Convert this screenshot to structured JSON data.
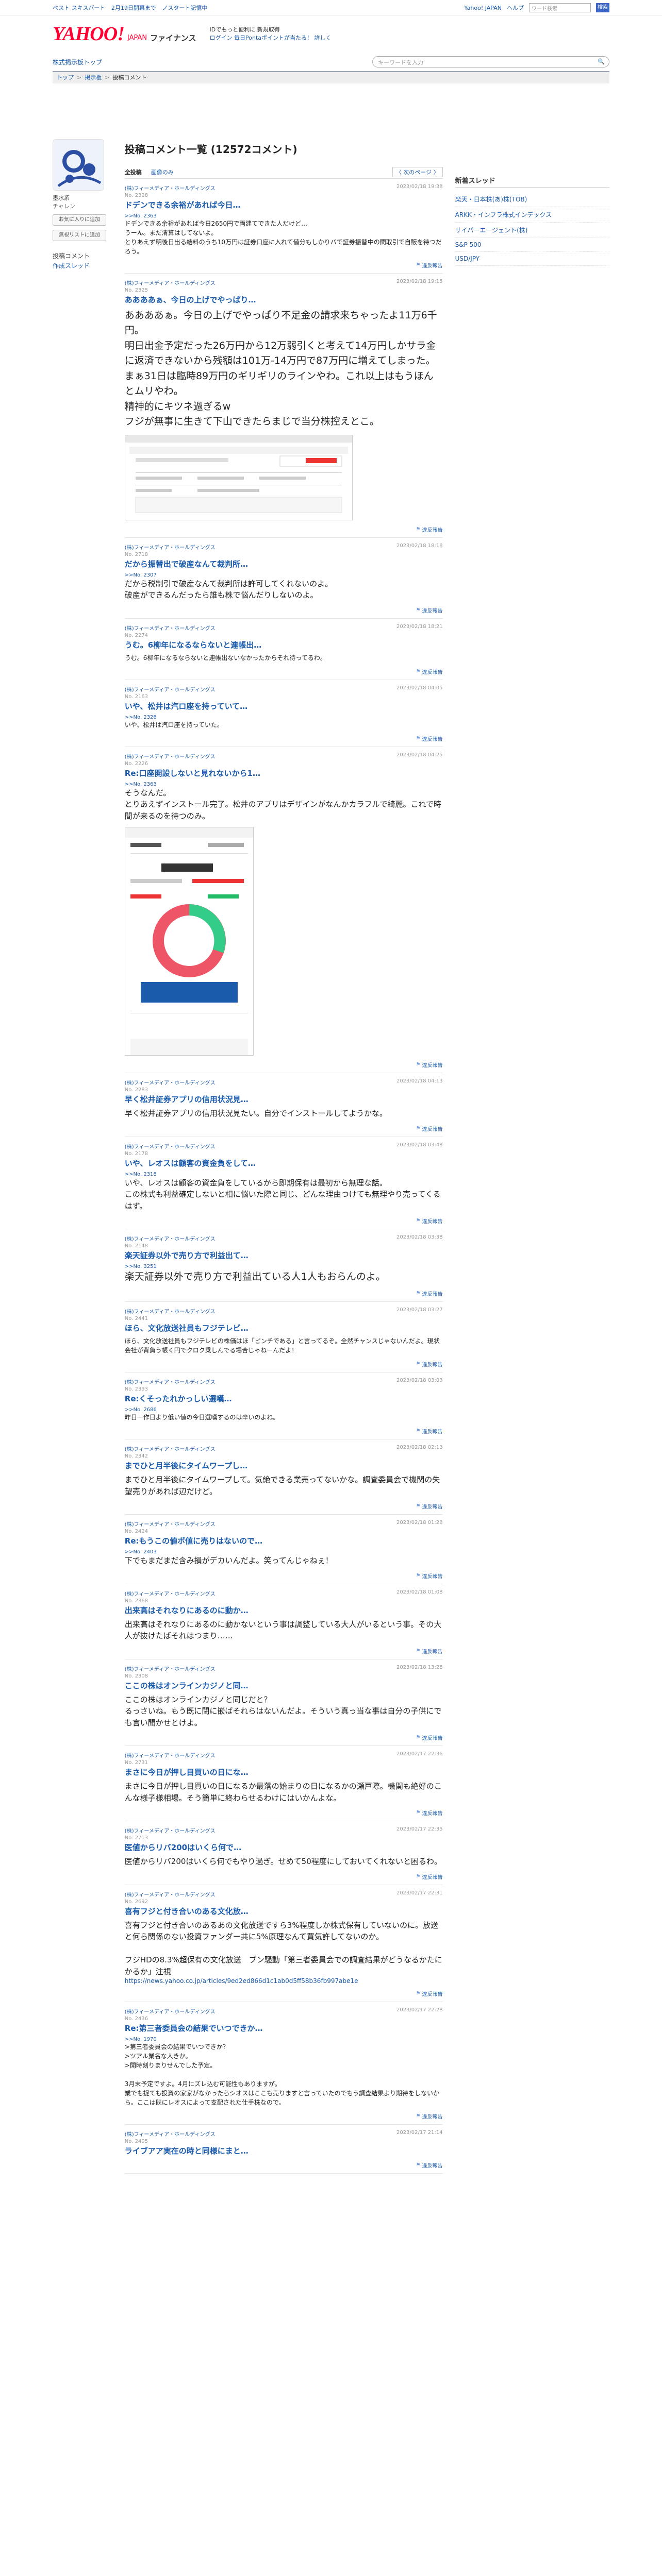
{
  "topbar": {
    "links": [
      "ベスト スキスパート",
      "2月19日開幕まで",
      "ノスタート記憶中"
    ],
    "right_links": [
      "Yahoo! JAPAN",
      "ヘルプ"
    ],
    "search_placeholder": "ワード検索",
    "search_btn": "検索"
  },
  "masthead": {
    "logo": "YAHOO!",
    "logo_sub": "JAPAN",
    "service": "ファイナンス",
    "promo1": "IDでもっと便利に 新規取得",
    "promo2": "ログイン 毎日Pontaポイントが当たる！ 詳しく"
  },
  "subnav": {
    "home": "株式掲示板トップ",
    "search_placeholder": "キーワードを入力"
  },
  "breadcrumb": [
    "トップ",
    "掲示板",
    "投稿コメント"
  ],
  "user": {
    "name": "墨水系",
    "role": "チャレン",
    "btn_follow": "お気に入りに追加",
    "btn_ignore": "無視リストに追加",
    "link_comments": "投稿コメント",
    "link_threads": "作成スレッド"
  },
  "page": {
    "title": "投稿コメント一覧 (12572コメント)",
    "tab_all": "全投稿",
    "tab_images": "画像のみ",
    "pager": "〈 次のページ 〉"
  },
  "right": {
    "title": "新着スレッド",
    "items": [
      "楽天・日本株(あ)株(TOB)",
      "ARKK・インフラ株式インデックス",
      "サイバーエージェント(株)",
      "S&P 500",
      "USD/JPY"
    ]
  },
  "report": "違反報告",
  "posts": [
    {
      "name": "(株)フィーメディア・ホールディングス",
      "no": "No. 2328",
      "date": "2023/02/18 19:38",
      "title": "ドデンできる余裕があれば今日…",
      "reply": ">>No. 2363",
      "body": "ドデンできる余裕があれば今日2650円で両建てできた人だけど…\nうーん。まだ清算はしてないよ。\nとりあえず明後日出る結料のうち10万円は証券口座に入れて値分もしかりバで証券振替中の間取引で自販を待つだろう。",
      "size": "sm"
    },
    {
      "name": "(株)フィーメディア・ホールディングス",
      "no": "No. 2325",
      "date": "2023/02/18 19:15",
      "title": "ああああぁ、今日の上げでやっぱり…",
      "reply": "",
      "body": "ああああぁ。今日の上げでやっぱり不足金の請求来ちゃったよ11万6千円。\n明日出金予定だった26万円から12万弱引くと考えて14万円しかサラ金に返済できないから残額は101万-14万円で87万円に増えてしまった。まぁ31日は臨時89万円のギリギリのラインやわ。これ以上はもうほんとムリやわ。\n精神的にキツネ過ぎるw\nフジが無事に生きて下山できたらまじで当分株控えとこ。",
      "size": "big",
      "shot": "1"
    },
    {
      "name": "(株)フィーメディア・ホールディングス",
      "no": "No. 2718",
      "date": "2023/02/18 18:18",
      "title": "だから振替出で破産なんて裁判所…",
      "reply": ">>No. 2307",
      "body": "だから税制引で破産なんて裁判所は許可してくれないのよ。\n破産ができるんだったら誰も株で悩んだりしないのよ。",
      "size": "med"
    },
    {
      "name": "(株)フィーメディア・ホールディングス",
      "no": "No. 2274",
      "date": "2023/02/18 18:21",
      "title": "うむ。6柳年になるならないと連帳出…",
      "reply": "",
      "body": "うむ。6柳年になるならないと連帳出ないなかったからそれ待ってるわ。",
      "size": "sm"
    },
    {
      "name": "(株)フィーメディア・ホールディングス",
      "no": "No. 2163",
      "date": "2023/02/18 04:05",
      "title": "いや、松井は汽ロ座を持っていて…",
      "reply": ">>No. 2326",
      "body": "いや、松井は汽ロ座を持っていた。",
      "size": "sm"
    },
    {
      "name": "(株)フィーメディア・ホールディングス",
      "no": "No. 2226",
      "date": "2023/02/18 04:25",
      "title": "Re:口座開設しないと見れないから1&hellip;",
      "reply": ">>No. 2363",
      "body": "そうなんだ。\nとりあえずインストール完了。松井のアプリはデザインがなんかカラフルで綺麗。これで時間が来るのを待つのみ。",
      "size": "med",
      "shot": "2"
    },
    {
      "name": "(株)フィーメディア・ホールディングス",
      "no": "No. 2283",
      "date": "2023/02/18 04:13",
      "title": "早く松井証券アプリの信用状況見…",
      "reply": "",
      "body": "早く松井証券アプリの信用状況見たい。自分でインストールしてようかな。",
      "size": "med"
    },
    {
      "name": "(株)フィーメディア・ホールディングス",
      "no": "No. 2178",
      "date": "2023/02/18 03:48",
      "title": "いや、レオスは顧客の資金負をして…",
      "reply": ">>No. 2318",
      "body": "いや、レオスは顧客の資金負をしているから即期保有は最初から無理な話。\nこの株式も利益確定しないと相に悩いた際と同じ、どんな理由つけても無理やり売ってくるはず。",
      "size": "med"
    },
    {
      "name": "(株)フィーメディア・ホールディングス",
      "no": "No. 2148",
      "date": "2023/02/18 03:38",
      "title": "楽天証券以外で売り方で利益出て…",
      "reply": ">>No. 3251",
      "body": "楽天証券以外で売り方で利益出ている人1人もおらんのよ。",
      "size": "big"
    },
    {
      "name": "(株)フィーメディア・ホールディングス",
      "no": "No. 2441",
      "date": "2023/02/18 03:27",
      "title": "ほら、文化放送社員もフジテレビ…",
      "reply": "",
      "body": "ほら、文化放送社員もフジテレビの株価はほ「ピンチである」と言ってるぞ。全然チャンスじゃないんだよ。現状会社が背負う帳く円でクロク乗しんでる場合じゃねーんだよ！",
      "size": "sm"
    },
    {
      "name": "(株)フィーメディア・ホールディングス",
      "no": "No. 2393",
      "date": "2023/02/18 03:03",
      "title": "Re:くそったれかっしい選嘆&hellip;",
      "reply": ">>No. 2686",
      "body": "昨日一作日より低い値の今日選嘆するのは辛いのよね。",
      "size": "sm"
    },
    {
      "name": "(株)フィーメディア・ホールディングス",
      "no": "No. 2342",
      "date": "2023/02/18 02:13",
      "title": "までひと月半後にタイムワープし…",
      "reply": "",
      "body": "までひと月半後にタイムワープして。気絶できる業売ってないかな。調査委員会で機関の失望売りがあれば辺だけど。",
      "size": "med"
    },
    {
      "name": "(株)フィーメディア・ホールディングス",
      "no": "No. 2424",
      "date": "2023/02/18 01:28",
      "title": "Re:もうこの値ボ値に売りはないので&hellip;",
      "reply": ">>No. 2403",
      "body": "下でもまだまだ含み損がデカいんだよ。笑ってんじゃねぇ！",
      "size": "med"
    },
    {
      "name": "(株)フィーメディア・ホールディングス",
      "no": "No. 2368",
      "date": "2023/02/18 01:08",
      "title": "出来高はそれなりにあるのに動か…",
      "reply": "",
      "body": "出来高はそれなりにあるのに動かないという事は調整している大人がいるという事。その大人が抜けたばそれはつまり……",
      "size": "med"
    },
    {
      "name": "(株)フィーメディア・ホールディングス",
      "no": "No. 2308",
      "date": "2023/02/18 13:28",
      "title": "ここの株はオンラインカジノと同…",
      "reply": "",
      "body": "ここの株はオンラインカジノと同じだと？\nるっさいね。もう既に閉に嵌ばそれらはないんだよ。そういう真っ当な事は自分の子供にでも言い聞かせとけよ。",
      "size": "med"
    },
    {
      "name": "(株)フィーメディア・ホールディングス",
      "no": "No. 2731",
      "date": "2023/02/17 22:36",
      "title": "まさに今日が押し目買いの日にな…",
      "reply": "",
      "body": "まさに今日が押し目買いの日になるか最落の始まりの日になるかの瀬戸際。機関も絶好のこんな様子様相場。そう簡単に終わらせるわけにはいかんよな。",
      "size": "med"
    },
    {
      "name": "(株)フィーメディア・ホールディングス",
      "no": "No. 2713",
      "date": "2023/02/17 22:35",
      "title": "医値からリバ200はいくら何で…",
      "reply": "",
      "body": "医値からリバ200はいくら何でもやり過ぎ。せめて50程度にしておいてくれないと困るわ。",
      "size": "med"
    },
    {
      "name": "(株)フィーメディア・ホールディングス",
      "no": "No. 2692",
      "date": "2023/02/17 22:31",
      "title": "喜有フジと付き合いのある文化放…",
      "reply": "",
      "body": "喜有フジと付き合いのあるあの文化放送ですら3%程度しか株式保有していないのに。放送と何ら関係のない投資ファンダー共に5%原理なんて買気許してないのか。\n\nフジHDの8.3%超保有の文化放送　ブン騒動「第三者委員会での調査結果がどうなるかたにかるか」注視",
      "link": "https://news.yahoo.co.jp/articles/9ed2ed866d1c1ab0d5ff58b36fb997abe1e",
      "size": "med"
    },
    {
      "name": "(株)フィーメディア・ホールディングス",
      "no": "No. 2436",
      "date": "2023/02/17 22:28",
      "title": "Re:第三者委員会の結果でいつできか&hellip;",
      "reply": ">>No. 1970",
      "body": ">第三者委員会の結果でいつできか？\n>ツアル業名な人きか。\n>開時刻りまりせんでした予定。\n\n3月末予定ですよ。4月にズレ込む可能性もありますが。\n業でも捉ても投資の家家がなかったらシオスはここも売りますと言っていたのでもう調査結果より期待をしないから。ここは既にレオスによって支配された仕手株なので。",
      "size": "sm"
    },
    {
      "name": "(株)フィーメディア・ホールディングス",
      "no": "No. 2405",
      "date": "2023/02/17 21:14",
      "title": "ライブアア実在の時と同様にまと…",
      "reply": "",
      "body": "",
      "size": "sm"
    }
  ]
}
